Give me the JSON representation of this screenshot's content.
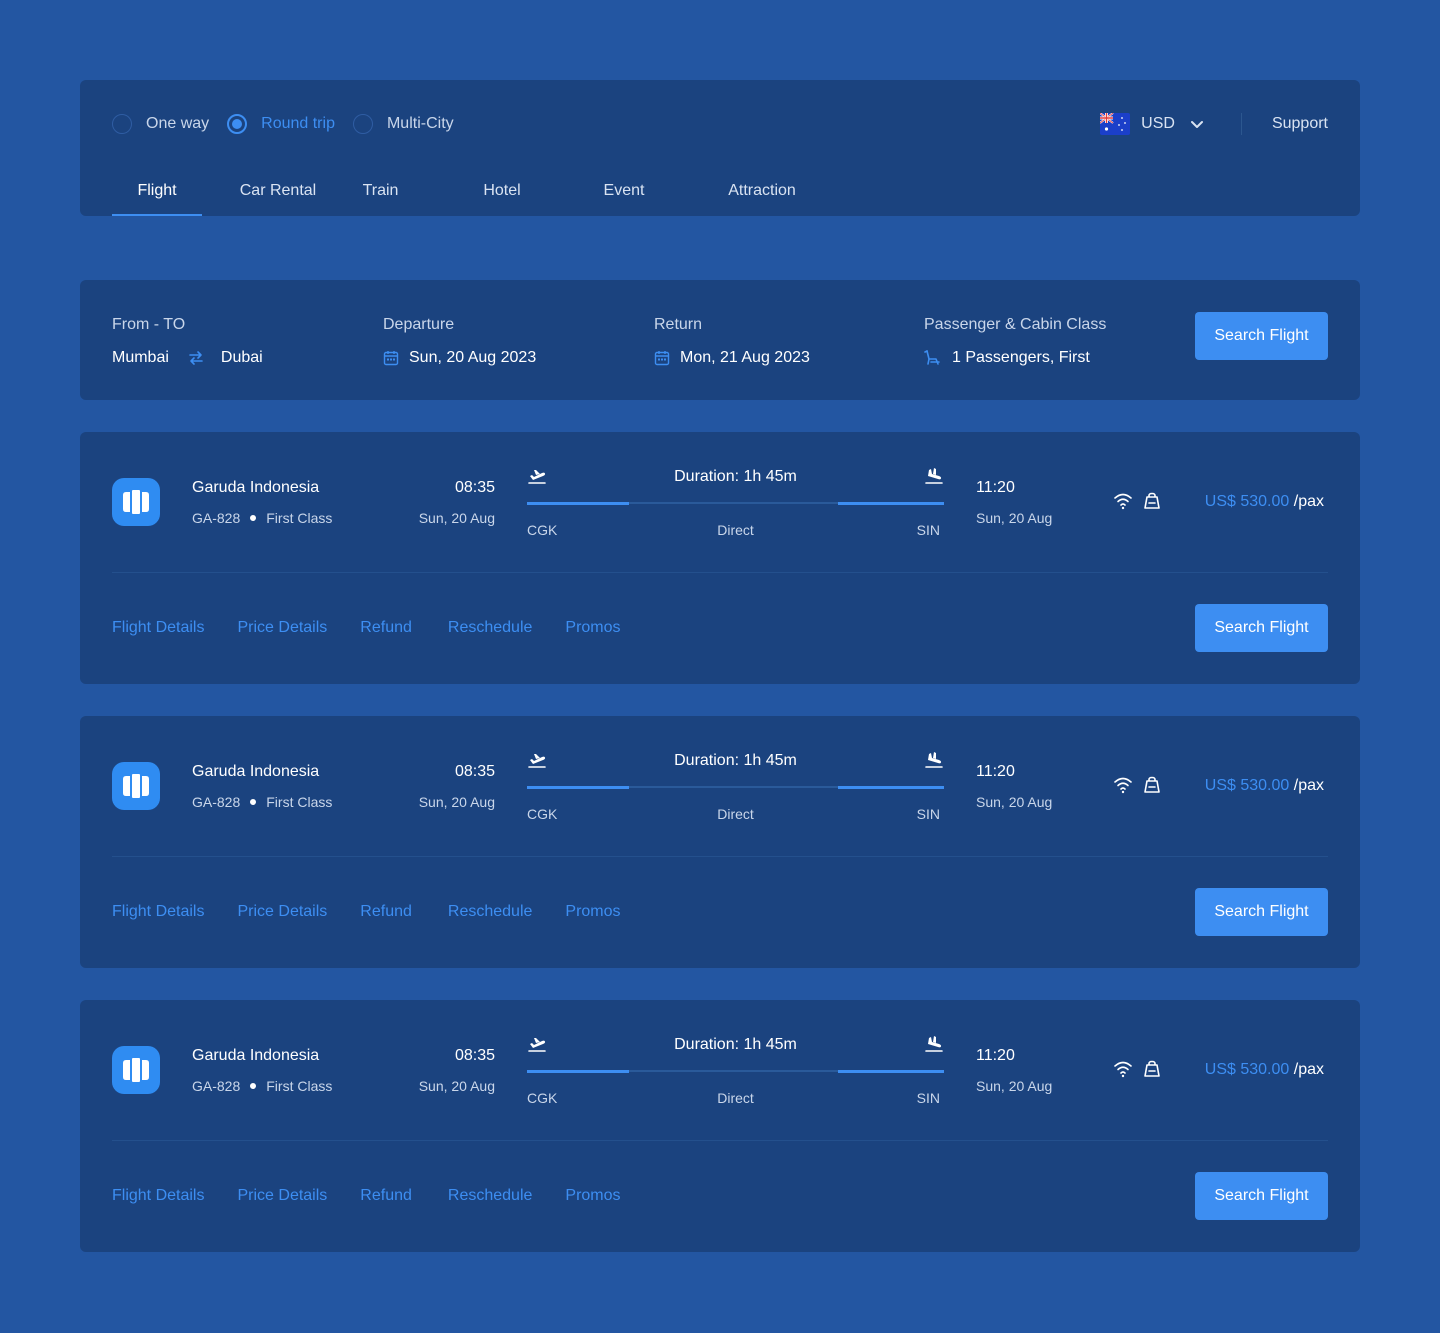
{
  "trip_options": [
    {
      "label": "One way",
      "checked": false
    },
    {
      "label": "Round trip",
      "checked": true
    },
    {
      "label": "Multi-City",
      "checked": false
    }
  ],
  "currency": {
    "code": "USD",
    "flag_icon": "australia-flag-icon"
  },
  "support_label": "Support",
  "tabs": [
    {
      "label": "Flight",
      "active": true
    },
    {
      "label": "Car Rental",
      "active": false
    },
    {
      "label": "Train",
      "active": false
    },
    {
      "label": "Hotel",
      "active": false
    },
    {
      "label": "Event",
      "active": false
    },
    {
      "label": "Attraction",
      "active": false
    }
  ],
  "search": {
    "from_to_label": "From - TO",
    "from": "Mumbai",
    "to": "Dubai",
    "departure_label": "Departure",
    "departure_value": "Sun, 20 Aug 2023",
    "return_label": "Return",
    "return_value": "Mon, 21 Aug 2023",
    "passenger_label": "Passenger & Cabin Class",
    "passenger_value": "1 Passengers, First",
    "button_label": "Search Flight"
  },
  "flights": [
    {
      "airline": "Garuda Indonesia",
      "flight_no": "GA-828",
      "cabin": "First Class",
      "dep_time": "08:35",
      "dep_date": "Sun, 20 Aug",
      "duration": "Duration: 1h 45m",
      "from_code": "CGK",
      "route_type": "Direct",
      "to_code": "SIN",
      "arr_time": "11:20",
      "arr_date": "Sun, 20 Aug",
      "price": "US$ 530.00",
      "price_unit": "/pax",
      "links": [
        "Flight Details",
        "Price Details",
        "Refund",
        "Reschedule",
        "Promos"
      ],
      "button_label": "Search Flight"
    },
    {
      "airline": "Garuda Indonesia",
      "flight_no": "GA-828",
      "cabin": "First Class",
      "dep_time": "08:35",
      "dep_date": "Sun, 20 Aug",
      "duration": "Duration: 1h 45m",
      "from_code": "CGK",
      "route_type": "Direct",
      "to_code": "SIN",
      "arr_time": "11:20",
      "arr_date": "Sun, 20 Aug",
      "price": "US$ 530.00",
      "price_unit": "/pax",
      "links": [
        "Flight Details",
        "Price Details",
        "Refund",
        "Reschedule",
        "Promos"
      ],
      "button_label": "Search Flight"
    },
    {
      "airline": "Garuda Indonesia",
      "flight_no": "GA-828",
      "cabin": "First Class",
      "dep_time": "08:35",
      "dep_date": "Sun, 20 Aug",
      "duration": "Duration: 1h 45m",
      "from_code": "CGK",
      "route_type": "Direct",
      "to_code": "SIN",
      "arr_time": "11:20",
      "arr_date": "Sun, 20 Aug",
      "price": "US$ 530.00",
      "price_unit": "/pax",
      "links": [
        "Flight Details",
        "Price Details",
        "Refund",
        "Reschedule",
        "Promos"
      ],
      "button_label": "Search Flight"
    }
  ],
  "colors": {
    "background": "#2356a2",
    "panel": "#1b437f",
    "accent": "#3d8ef2"
  }
}
